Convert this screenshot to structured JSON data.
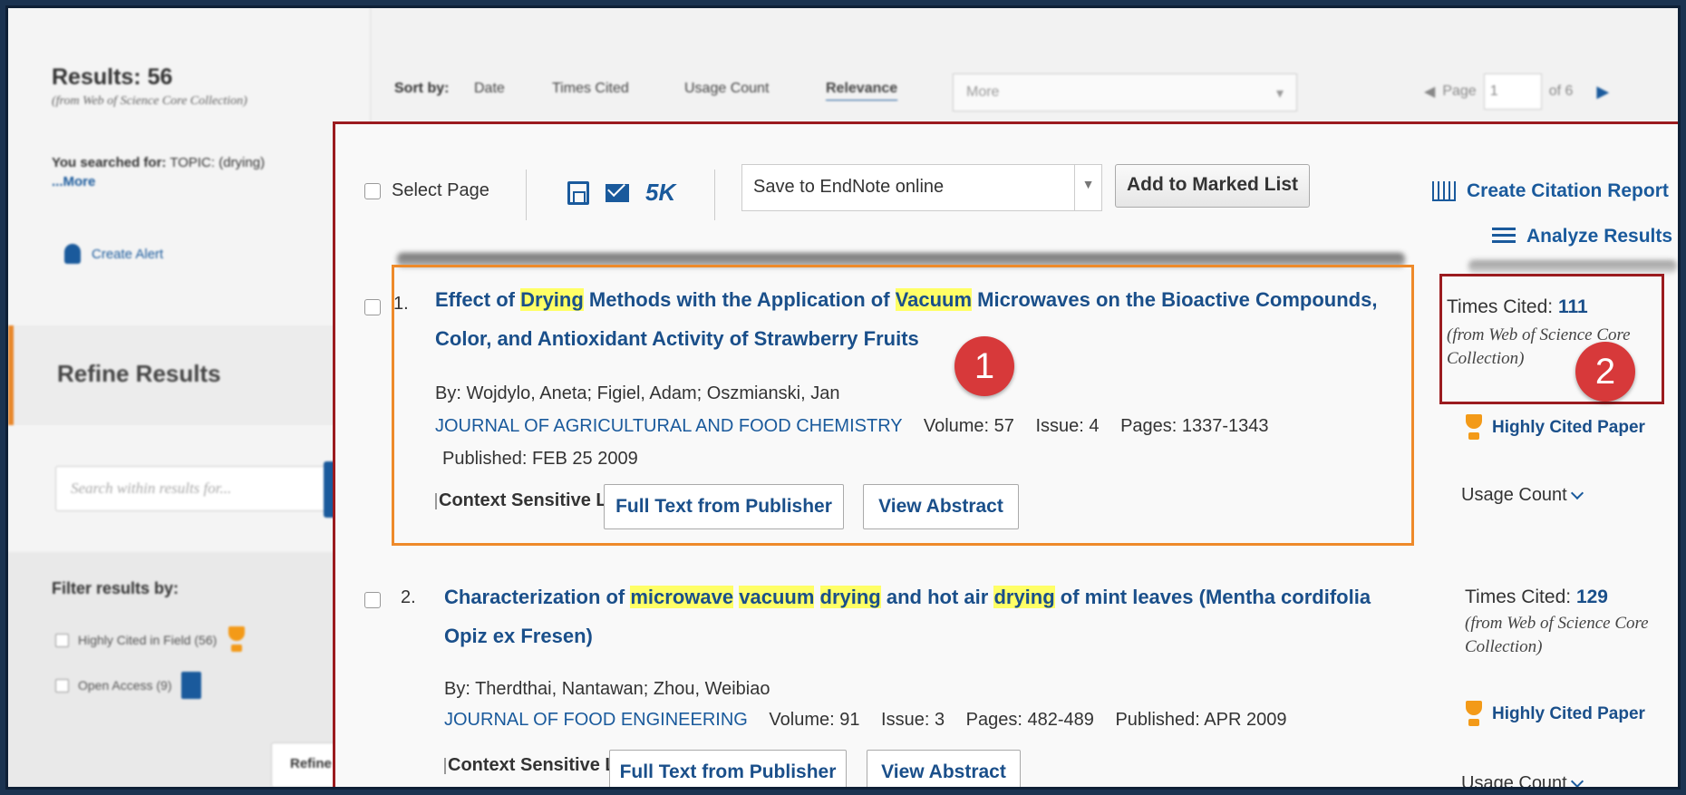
{
  "sidebar": {
    "results_title": "Results: 56",
    "results_source": "(from Web of Science Core Collection)",
    "searched_label": "You searched for:",
    "searched_query": "TOPIC: (drying)",
    "searched_more": "...More",
    "create_alert": "Create Alert",
    "refine_title": "Refine Results",
    "search_placeholder": "Search within results for...",
    "filter_title": "Filter results by:",
    "filters": [
      {
        "label": "Highly Cited in Field (56)"
      },
      {
        "label": "Open Access (9)"
      }
    ],
    "refine_button": "Refine"
  },
  "sortbar": {
    "label": "Sort by:",
    "options": [
      "Date",
      "Times Cited",
      "Usage Count",
      "Relevance"
    ],
    "active": "Relevance",
    "more": "More",
    "page_label": "Page",
    "page_value": "1",
    "page_of": "of  6"
  },
  "toolbar": {
    "select_page": "Select Page",
    "five_k": "5K",
    "save_option": "Save to EndNote online",
    "add_marked": "Add to Marked List",
    "citation_report": "Create Citation Report",
    "analyze_results": "Analyze Results"
  },
  "records": [
    {
      "num": "1.",
      "title_parts": [
        {
          "t": "Effect of ",
          "hl": false
        },
        {
          "t": "Drying",
          "hl": true
        },
        {
          "t": " Methods with the Application of ",
          "hl": false
        },
        {
          "t": "Vacuum",
          "hl": true
        },
        {
          "t": " Microwaves on the Bioactive Compounds, Color, and Antioxidant Activity of Strawberry Fruits",
          "hl": false
        }
      ],
      "authors": "By: Wojdylo, Aneta; Figiel, Adam; Oszmianski, Jan",
      "journal": "JOURNAL OF AGRICULTURAL AND FOOD CHEMISTRY",
      "volume": "Volume: 57",
      "issue": "Issue: 4",
      "pages": "Pages: 1337-1343",
      "published": "Published: FEB 25 2009",
      "context_link": "Context Sensitive Links",
      "full_text": "Full Text from Publisher",
      "view_abstract": "View Abstract",
      "times_cited_label": "Times Cited:",
      "times_cited": "111",
      "cited_source": "(from Web of Science Core Collection)",
      "highly_cited": "Highly Cited Paper",
      "usage_count": "Usage Count"
    },
    {
      "num": "2.",
      "title_parts": [
        {
          "t": "Characterization of ",
          "hl": false
        },
        {
          "t": "microwave",
          "hl": true
        },
        {
          "t": " ",
          "hl": false
        },
        {
          "t": "vacuum",
          "hl": true
        },
        {
          "t": " ",
          "hl": false
        },
        {
          "t": "drying",
          "hl": true
        },
        {
          "t": " and hot air ",
          "hl": false
        },
        {
          "t": "drying",
          "hl": true
        },
        {
          "t": " of mint leaves (Mentha cordifolia Opiz ex Fresen)",
          "hl": false
        }
      ],
      "authors": "By: Therdthai, Nantawan; Zhou, Weibiao",
      "journal": "JOURNAL OF FOOD ENGINEERING",
      "volume": "Volume: 91",
      "issue": "Issue: 3",
      "pages": "Pages: 482-489",
      "published": "Published: APR 2009",
      "context_link": "Context Sensitive Links",
      "full_text": "Full Text from Publisher",
      "view_abstract": "View Abstract",
      "times_cited_label": "Times Cited:",
      "times_cited": "129",
      "cited_source": "(from Web of Science Core Collection)",
      "highly_cited": "Highly Cited Paper",
      "usage_count": "Usage Count"
    }
  ],
  "callouts": [
    "1",
    "2"
  ],
  "colors": {
    "link": "#1a4f8a",
    "highlight": "#ffff66",
    "callout": "#d7393a",
    "focus_orange": "#ee8a2a",
    "focus_red": "#9b1b1f",
    "page_border": "#1b3350"
  }
}
